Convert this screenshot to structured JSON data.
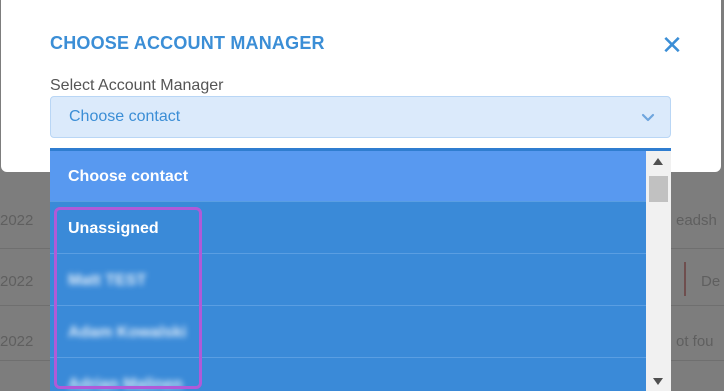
{
  "background": {
    "left_texts": [
      "2022",
      "2022",
      "2022"
    ],
    "right_texts": [
      "eadsh",
      "De",
      "ot fou"
    ]
  },
  "modal": {
    "title": "CHOOSE ACCOUNT MANAGER",
    "close_label": "✕",
    "field_label": "Select Account Manager",
    "select_value": "Choose contact"
  },
  "dropdown": {
    "options": [
      {
        "label": "Choose contact"
      },
      {
        "label": "Unassigned"
      },
      {
        "label": "Matt TEST"
      },
      {
        "label": "Adam Kowalski"
      },
      {
        "label": "Adrian Malinen"
      }
    ]
  },
  "colors": {
    "accent": "#3b8ed6",
    "dropdown_bg": "#3a8ad8",
    "selected_option": "#5899f0",
    "highlight": "#b05ad8"
  },
  "icons": {
    "close": "close-icon",
    "chevron": "chevron-down-icon",
    "scroll_up": "scroll-up-arrow-icon",
    "scroll_down": "scroll-down-arrow-icon"
  }
}
